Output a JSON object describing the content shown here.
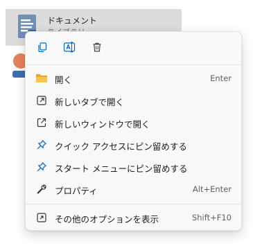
{
  "background": {
    "selected_item_title": "ドキュメント",
    "selected_item_subtitle": "ライブラリ"
  },
  "menu": {
    "quick_actions": [
      {
        "name": "copy",
        "icon": "copy-icon"
      },
      {
        "name": "rename",
        "icon": "rename-icon"
      },
      {
        "name": "delete",
        "icon": "trash-icon"
      }
    ],
    "items": [
      {
        "label": "開く",
        "shortcut": "Enter",
        "icon": "folder-icon"
      },
      {
        "label": "新しいタブで開く",
        "shortcut": "",
        "icon": "open-in-new-tab-icon"
      },
      {
        "label": "新しいウィンドウで開く",
        "shortcut": "",
        "icon": "open-in-new-window-icon"
      },
      {
        "label": "クイック アクセスにピン留めする",
        "shortcut": "",
        "icon": "pin-icon"
      },
      {
        "label": "スタート メニューにピン留めする",
        "shortcut": "",
        "icon": "pin-icon"
      },
      {
        "label": "プロパティ",
        "shortcut": "Alt+Enter",
        "icon": "wrench-icon"
      }
    ],
    "more_options": {
      "label": "その他のオプションを表示",
      "shortcut": "Shift+F10",
      "icon": "more-options-icon"
    }
  },
  "colors": {
    "accent": "#0067c0",
    "folder_yellow": "#f2c14e"
  }
}
